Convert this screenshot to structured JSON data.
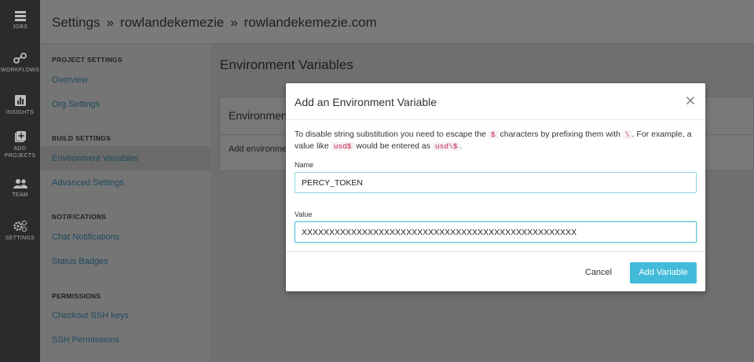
{
  "rail": {
    "items": [
      {
        "label": "JOBS",
        "icon": "jobs-icon"
      },
      {
        "label": "WORKFLOWS",
        "icon": "workflows-icon"
      },
      {
        "label": "INSIGHTS",
        "icon": "insights-icon"
      },
      {
        "label": "ADD PROJECTS",
        "label_line1": "ADD",
        "label_line2": "PROJECTS",
        "icon": "add-projects-icon"
      },
      {
        "label": "TEAM",
        "icon": "team-icon"
      },
      {
        "label": "SETTINGS",
        "icon": "settings-icon"
      }
    ]
  },
  "header": {
    "crumbs": [
      "Settings",
      "rowlandekemezie",
      "rowlandekemezie.com"
    ],
    "separator": "»"
  },
  "sidebar": {
    "sections": [
      {
        "heading": "PROJECT SETTINGS",
        "links": [
          "Overview",
          "Org Settings"
        ]
      },
      {
        "heading": "BUILD SETTINGS",
        "links": [
          "Environment Variables",
          "Advanced Settings"
        ]
      },
      {
        "heading": "NOTIFICATIONS",
        "links": [
          "Chat Notifications",
          "Status Badges"
        ]
      },
      {
        "heading": "PERMISSIONS",
        "links": [
          "Checkout SSH keys",
          "SSH Permissions"
        ]
      }
    ],
    "active": "Environment Variables"
  },
  "main": {
    "title": "Environment Variables",
    "card_title": "Environment",
    "card_text": "Add environmen"
  },
  "modal": {
    "title": "Add an Environment Variable",
    "help": {
      "part1": "To disable string substitution you need to escape the ",
      "code1": "$",
      "part2": " characters by prefixing them with ",
      "code2": "\\",
      "part3": ". For example, a value like ",
      "code3": "usd$",
      "part4": " would be entered as ",
      "code4": "usd\\$",
      "part5": "."
    },
    "name_label": "Name",
    "name_value": "PERCY_TOKEN",
    "value_label": "Value",
    "value_value": "XXXXXXXXXXXXXXXXXXXXXXXXXXXXXXXXXXXXXXXXXXXXXXXXXX",
    "cancel_label": "Cancel",
    "submit_label": "Add Variable"
  },
  "colors": {
    "accent": "#42bbda",
    "input_border": "#8ad3df",
    "code_text": "#c7254e"
  }
}
